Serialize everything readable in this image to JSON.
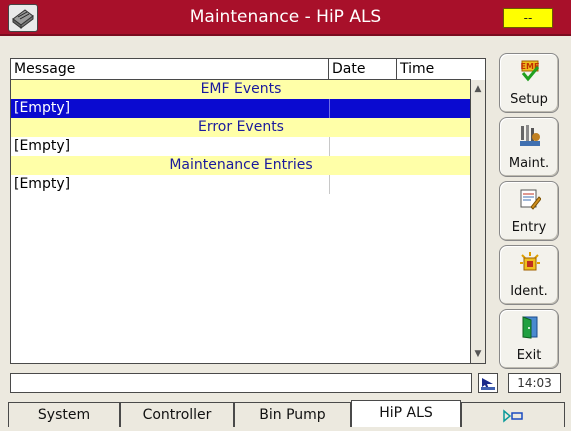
{
  "window": {
    "title": "Maintenance - HiP ALS",
    "status_led": "--",
    "app_icon": "module-icon",
    "led_color": "#ffff00"
  },
  "table": {
    "columns": [
      "Message",
      "Date",
      "Time"
    ],
    "sections": [
      {
        "title": "EMF Events",
        "entries": [
          {
            "message": "[Empty]",
            "selected": true
          }
        ]
      },
      {
        "title": "Error Events",
        "entries": [
          {
            "message": "[Empty]",
            "selected": false
          }
        ]
      },
      {
        "title": "Maintenance Entries",
        "entries": [
          {
            "message": "[Empty]",
            "selected": false
          }
        ]
      }
    ]
  },
  "side_buttons": [
    {
      "label": "Setup",
      "icon": "emf-setup-icon"
    },
    {
      "label": "Maint.",
      "icon": "maintenance-tools-icon"
    },
    {
      "label": "Entry",
      "icon": "log-entry-icon"
    },
    {
      "label": "Ident.",
      "icon": "identification-icon"
    },
    {
      "label": "Exit",
      "icon": "exit-door-icon"
    }
  ],
  "status": {
    "message": "",
    "time": "14:03",
    "status_icon": "network-icon"
  },
  "tabs": [
    {
      "label": "System",
      "active": false
    },
    {
      "label": "Controller",
      "active": false
    },
    {
      "label": "Bin Pump",
      "active": false
    },
    {
      "label": "HiP ALS",
      "active": true
    },
    {
      "label": "",
      "active": false,
      "icon": "play-view-icon"
    }
  ],
  "colors": {
    "title_bar": "#a8102a",
    "section_bg": "#ffffa8",
    "section_text": "#1a1a9e",
    "selection": "#0a0ad0"
  }
}
